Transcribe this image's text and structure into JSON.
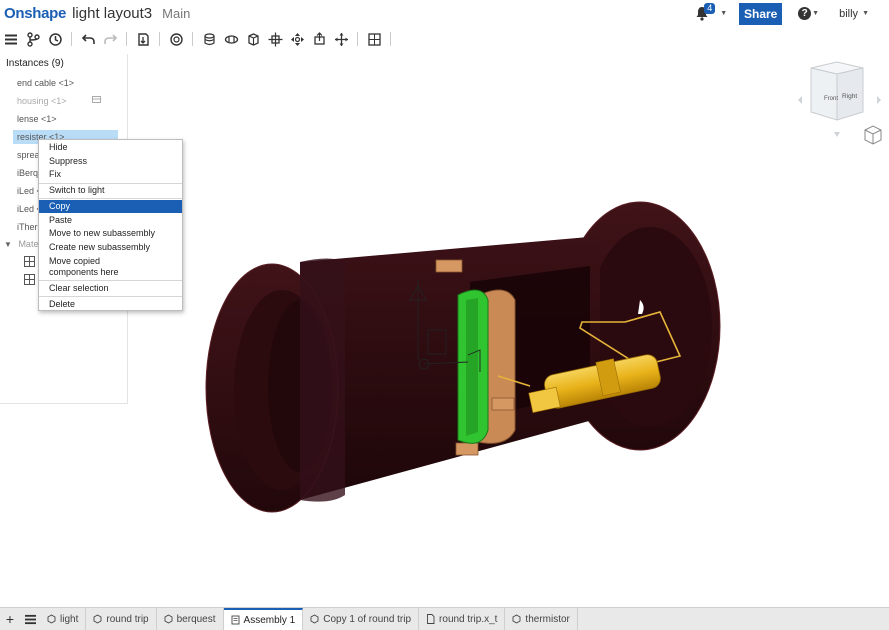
{
  "header": {
    "logo": "Onshape",
    "doc_name": "light layout3",
    "branch": "Main",
    "notifications_count": "4",
    "share_label": "Share",
    "user": "billy"
  },
  "toolbar": {
    "icons": [
      "menu-icon",
      "version-graph-icon",
      "history-icon",
      "undo-icon",
      "redo-icon",
      "insert-icon",
      "mate-connector-icon",
      "fastened-mate-icon",
      "revolute-mate-icon",
      "slider-mate-icon",
      "planar-mate-icon",
      "cylindrical-mate-icon",
      "pin-slot-mate-icon",
      "ball-mate-icon",
      "measure-icon"
    ]
  },
  "instances": {
    "title": "Instances (9)",
    "items": [
      {
        "label": "end cable <1>",
        "state": "normal"
      },
      {
        "label": "housing <1>",
        "state": "hidden"
      },
      {
        "label": "lense <1>",
        "state": "normal"
      },
      {
        "label": "resister <1>",
        "state": "selected"
      },
      {
        "label": "spreader <1>",
        "state": "normal"
      },
      {
        "label": "iBerq <1>",
        "state": "normal"
      },
      {
        "label": "iLed <1>",
        "state": "normal"
      },
      {
        "label": "iLed <2>",
        "state": "normal"
      },
      {
        "label": "iTherm <1>",
        "state": "normal"
      }
    ],
    "mates_label": "Mates"
  },
  "context_menu": {
    "items": [
      {
        "label": "Hide"
      },
      {
        "label": "Suppress"
      },
      {
        "label": "Fix"
      },
      {
        "label": "Switch to light"
      },
      {
        "label": "Copy",
        "highlighted": true
      },
      {
        "label": "Paste"
      },
      {
        "label": "Move to new subassembly"
      },
      {
        "label": "Create new subassembly"
      },
      {
        "label": "Move copied components here"
      },
      {
        "label": "Clear selection"
      },
      {
        "label": "Delete"
      }
    ]
  },
  "viewcube": {
    "front_label": "Front",
    "right_label": "Right"
  },
  "bottom_tabs": [
    {
      "label": "light",
      "icon": "part-studio-icon",
      "active": false
    },
    {
      "label": "round trip",
      "icon": "part-studio-icon",
      "active": false
    },
    {
      "label": "berquest",
      "icon": "part-studio-icon",
      "active": false
    },
    {
      "label": "Assembly 1",
      "icon": "assembly-icon",
      "active": true
    },
    {
      "label": "Copy 1 of round trip",
      "icon": "part-studio-icon",
      "active": false
    },
    {
      "label": "round trip.x_t",
      "icon": "file-icon",
      "active": false
    },
    {
      "label": "thermistor",
      "icon": "part-studio-icon",
      "active": false
    }
  ],
  "colors": {
    "brand": "#1a5fb4",
    "selection": "#b9dcf7",
    "housing": "#3a0f12",
    "ring_green": "#31c431",
    "ring_copper": "#c98a55",
    "component_yellow": "#e8b21a"
  }
}
